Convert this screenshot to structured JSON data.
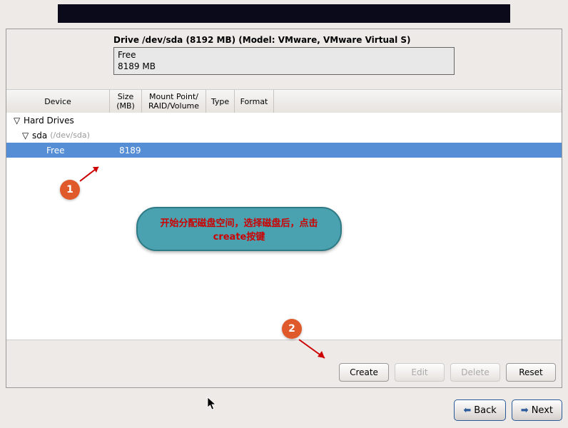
{
  "drive": {
    "title": "Drive /dev/sda (8192 MB) (Model: VMware, VMware Virtual S)",
    "box_line1": "Free",
    "box_line2": "8189 MB"
  },
  "columns": {
    "device": "Device",
    "size": "Size\n(MB)",
    "mount": "Mount Point/\nRAID/Volume",
    "type": "Type",
    "format": "Format"
  },
  "tree": {
    "root": "Hard Drives",
    "disk": "sda",
    "disk_sub": "(/dev/sda)",
    "free_label": "Free",
    "free_size": "8189"
  },
  "callout": {
    "text": "开始分配磁盘空间，选择磁盘后，点击create按键"
  },
  "buttons": {
    "create": "Create",
    "edit": "Edit",
    "delete": "Delete",
    "reset": "Reset",
    "back": "Back",
    "next": "Next"
  },
  "annotations": {
    "badge1": "1",
    "badge2": "2"
  }
}
